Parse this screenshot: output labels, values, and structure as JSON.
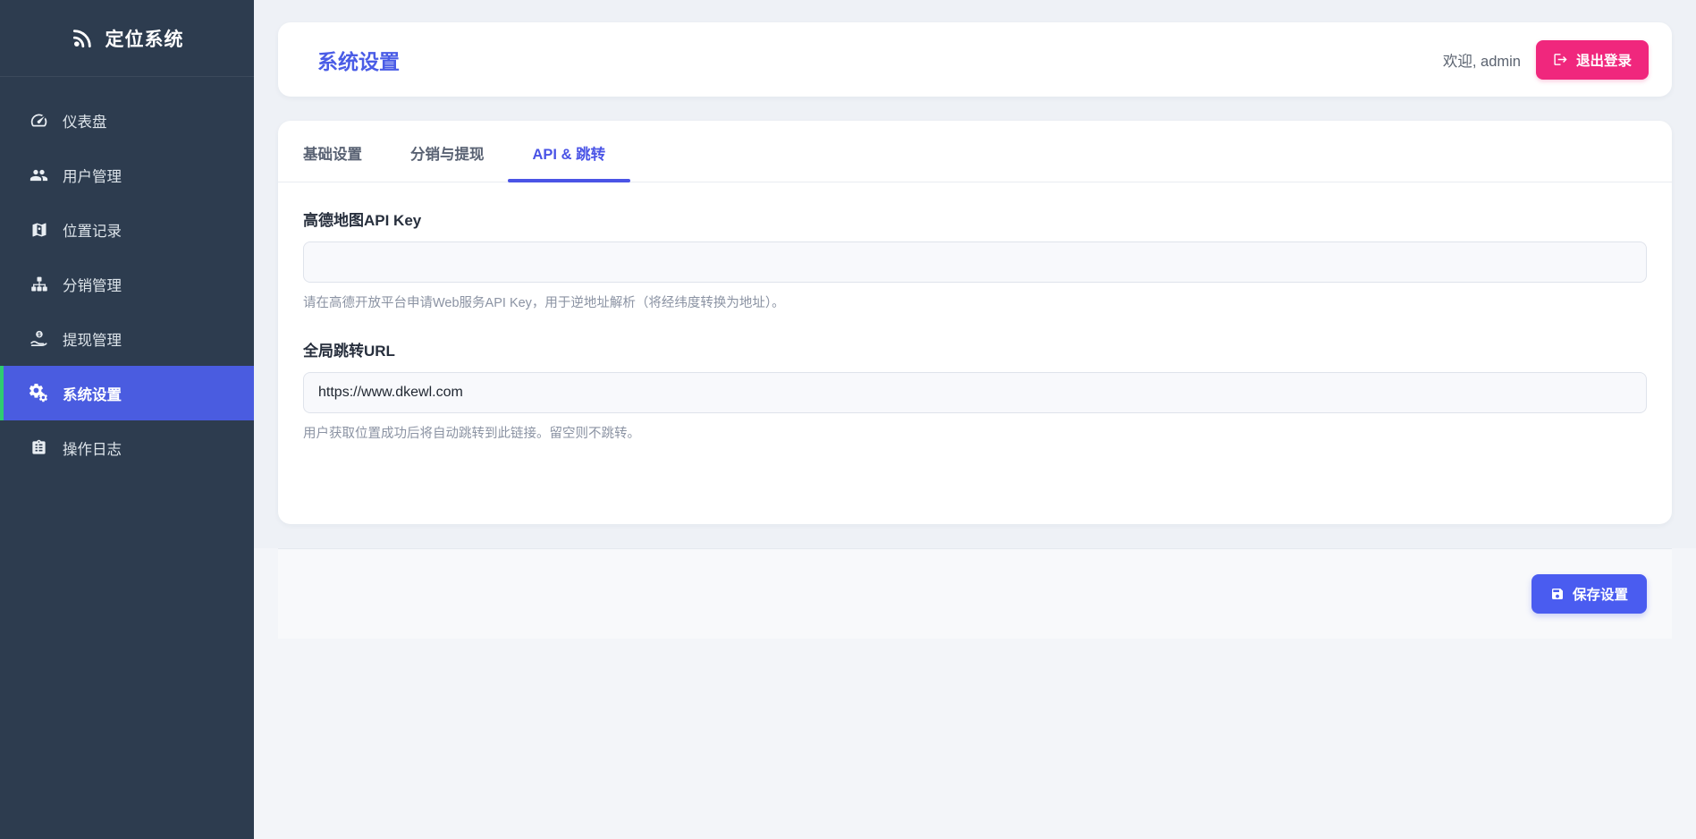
{
  "brand": {
    "name": "定位系统",
    "icon": "satellite-dish-icon"
  },
  "sidebar": {
    "items": [
      {
        "label": "仪表盘",
        "icon": "gauge-icon",
        "active": false
      },
      {
        "label": "用户管理",
        "icon": "users-icon",
        "active": false
      },
      {
        "label": "位置记录",
        "icon": "map-marked-icon",
        "active": false
      },
      {
        "label": "分销管理",
        "icon": "sitemap-icon",
        "active": false
      },
      {
        "label": "提现管理",
        "icon": "hand-holding-usd-icon",
        "active": false
      },
      {
        "label": "系统设置",
        "icon": "gears-icon",
        "active": true
      },
      {
        "label": "操作日志",
        "icon": "clipboard-list-icon",
        "active": false
      }
    ]
  },
  "header": {
    "title": "系统设置",
    "welcome": "欢迎, admin",
    "logout_label": "退出登录"
  },
  "tabs": [
    {
      "label": "基础设置",
      "active": false
    },
    {
      "label": "分销与提现",
      "active": false
    },
    {
      "label": "API & 跳转",
      "active": true
    }
  ],
  "form": {
    "fields": [
      {
        "label": "高德地图API Key",
        "value": "",
        "help": "请在高德开放平台申请Web服务API Key，用于逆地址解析（将经纬度转换为地址）。"
      },
      {
        "label": "全局跳转URL",
        "value": "https://www.dkewl.com",
        "help": "用户获取位置成功后将自动跳转到此链接。留空则不跳转。"
      }
    ],
    "save_label": "保存设置"
  },
  "colors": {
    "sidebar_bg": "#2d3c4f",
    "sidebar_active_bg": "#4a5ce0",
    "sidebar_active_border": "#2ecc71",
    "accent_blue": "#4a5cf0",
    "title_blue": "#4a5ce6",
    "logout_pink": "#f0277d",
    "page_bg_top": "#eef1f6",
    "page_bg_bottom": "#f3f5f9",
    "footer_bg": "#f8f9fb",
    "card_bg": "#ffffff",
    "help_text": "#8b93a3"
  }
}
